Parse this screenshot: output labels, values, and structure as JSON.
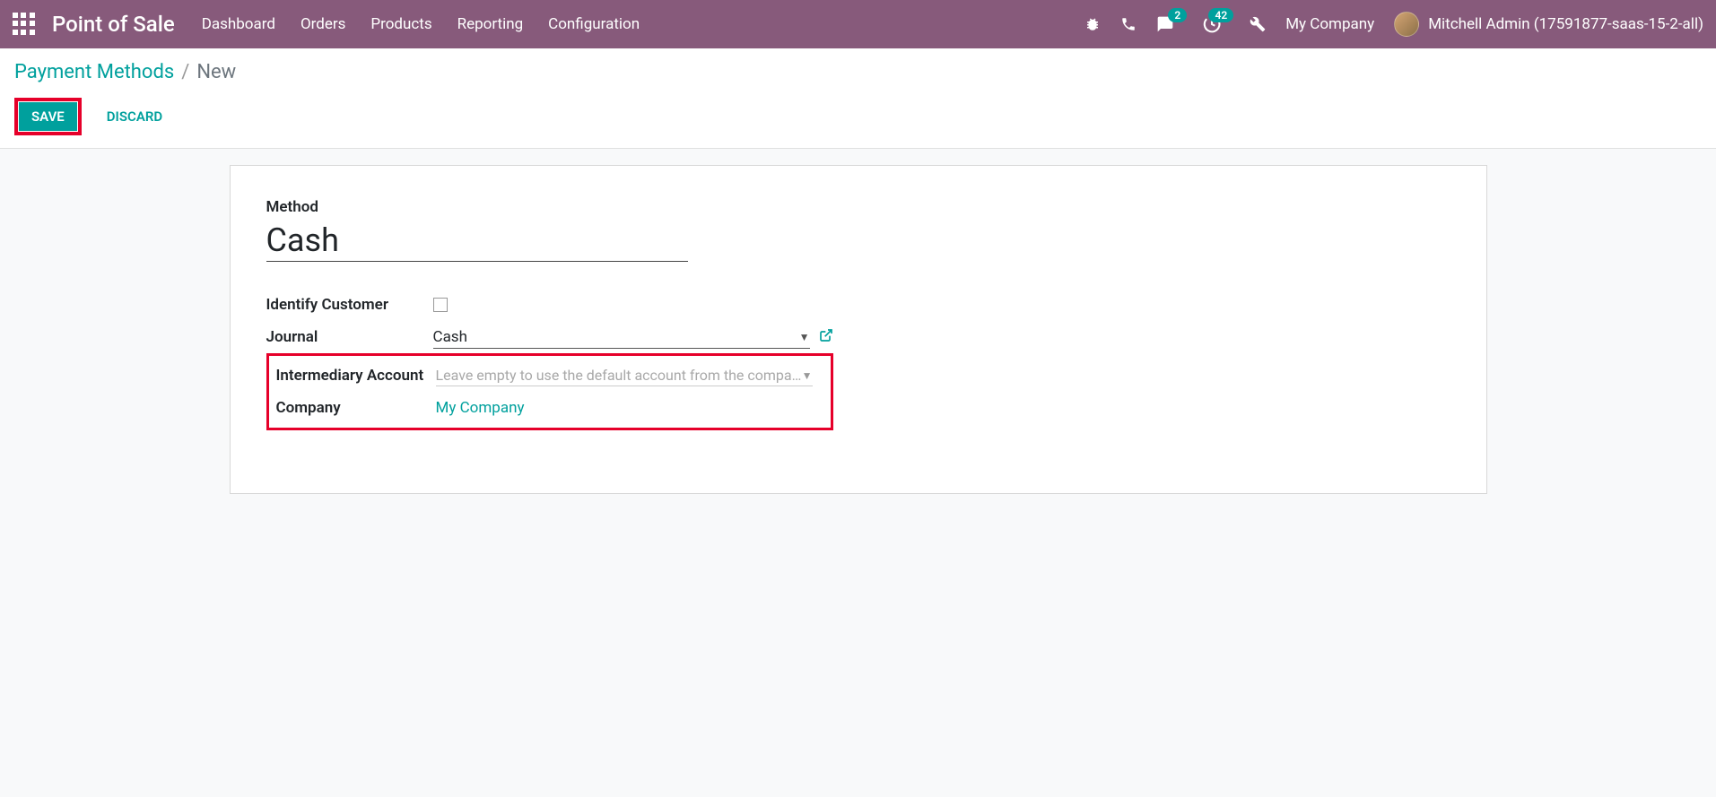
{
  "navbar": {
    "app_title": "Point of Sale",
    "menu": [
      "Dashboard",
      "Orders",
      "Products",
      "Reporting",
      "Configuration"
    ],
    "messaging_badge": "2",
    "activity_badge": "42",
    "company": "My Company",
    "user": "Mitchell Admin (17591877-saas-15-2-all)"
  },
  "breadcrumb": {
    "link": "Payment Methods",
    "current": "New"
  },
  "buttons": {
    "save": "SAVE",
    "discard": "DISCARD"
  },
  "form": {
    "method_label": "Method",
    "method_value": "Cash",
    "fields": {
      "identify_customer": "Identify Customer",
      "journal": "Journal",
      "journal_value": "Cash",
      "intermediary_account": "Intermediary Account",
      "intermediary_placeholder": "Leave empty to use the default account from the company",
      "company": "Company",
      "company_value": "My Company"
    }
  }
}
